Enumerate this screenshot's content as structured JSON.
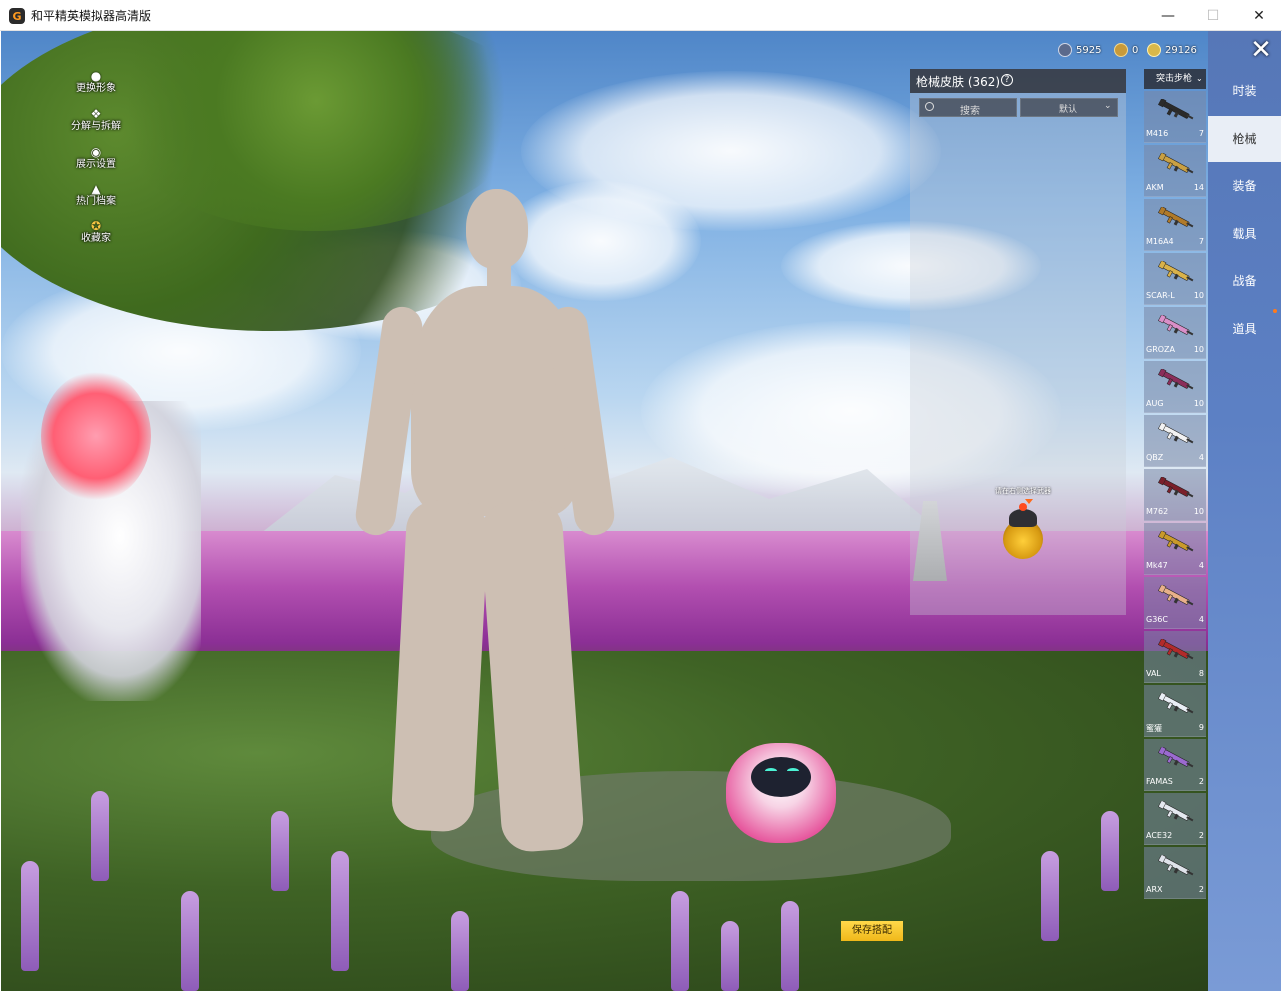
{
  "window": {
    "title": "和平精英模拟器高清版",
    "app_icon": "G",
    "minimize": "—",
    "maximize": "☐",
    "close": "✕"
  },
  "left_menu": [
    {
      "label": "更换形象",
      "icon": "person-icon"
    },
    {
      "label": "分解与拆解",
      "icon": "puzzle-icon"
    },
    {
      "label": "展示设置",
      "icon": "eye-icon"
    },
    {
      "label": "热门档案",
      "icon": "flame-icon"
    },
    {
      "label": "收藏家",
      "icon": "collector-badge-icon"
    }
  ],
  "currency": [
    {
      "value": "5925",
      "icon": "globe-coin-icon",
      "color": "#5b6a8c"
    },
    {
      "value": "0",
      "icon": "medal-coin-icon",
      "color": "#c89a3a"
    },
    {
      "value": "29126",
      "icon": "gold-coin-icon",
      "color": "#d9b84a"
    }
  ],
  "close_glyph": "✕",
  "skin_panel": {
    "title": "枪械皮肤 (362)",
    "help": "?",
    "search_placeholder": "搜索",
    "sort_label": "默认",
    "sort_chevron": "⌄",
    "hint": "请在右侧选择武器"
  },
  "gun_category": {
    "label": "突击步枪",
    "chevron": "⌄"
  },
  "guns": [
    {
      "name": "M416",
      "count": "7",
      "color": "#2b2b2b"
    },
    {
      "name": "AKM",
      "count": "14",
      "color": "#c9a043"
    },
    {
      "name": "M16A4",
      "count": "7",
      "color": "#b07a2a"
    },
    {
      "name": "SCAR-L",
      "count": "10",
      "color": "#d9b24a"
    },
    {
      "name": "GROZA",
      "count": "10",
      "color": "#d98fc8"
    },
    {
      "name": "AUG",
      "count": "10",
      "color": "#8b2d5a"
    },
    {
      "name": "QBZ",
      "count": "4",
      "color": "#f2f2f2"
    },
    {
      "name": "M762",
      "count": "10",
      "color": "#7a1f2a"
    },
    {
      "name": "Mk47",
      "count": "4",
      "color": "#c99a2a"
    },
    {
      "name": "G36C",
      "count": "4",
      "color": "#e8b08a"
    },
    {
      "name": "VAL",
      "count": "8",
      "color": "#b22a2a"
    },
    {
      "name": "蜜獾",
      "count": "9",
      "color": "#e9eef5"
    },
    {
      "name": "FAMAS",
      "count": "2",
      "color": "#9b6ad0"
    },
    {
      "name": "ACE32",
      "count": "2",
      "color": "#e4e8ef"
    },
    {
      "name": "ARX",
      "count": "2",
      "color": "#dfe3ea"
    }
  ],
  "right_tabs": [
    {
      "label": "时装",
      "active": false
    },
    {
      "label": "枪械",
      "active": true
    },
    {
      "label": "装备",
      "active": false
    },
    {
      "label": "载具",
      "active": false
    },
    {
      "label": "战备",
      "active": false
    },
    {
      "label": "道具",
      "active": false
    }
  ],
  "save_button": "保存搭配"
}
